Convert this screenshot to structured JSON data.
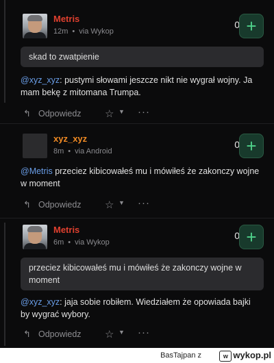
{
  "comments": [
    {
      "author": "Metris",
      "time": "12m",
      "source": "via Wykop",
      "votes": "0",
      "quote": "skad to zwatpienie",
      "mention": "@xyz_xyz",
      "text": ": pustymi słowami jeszcze nikt nie wygrał wojny. Ja mam bekę z mitomana Trumpa.",
      "reply_label": "Odpowiedz"
    },
    {
      "author": "xyz_xyz",
      "time": "8m",
      "source": "via Android",
      "votes": "0",
      "mention": "@Metris",
      "text": " przeciez kibicowałeś mu i mówiłeś że zakonczy wojne w moment",
      "reply_label": "Odpowiedz"
    },
    {
      "author": "Metris",
      "time": "6m",
      "source": "via Wykop",
      "votes": "0",
      "quote": "przeciez kibicowałeś mu i mówiłeś że zakonczy wojne w moment",
      "mention": "@xyz_xyz",
      "text": ": jaja sobie robiłem. Wiedziałem że opowiada bajki by wygrać wybory.",
      "reply_label": "Odpowiedz"
    }
  ],
  "footer": {
    "attribution": "BasTajpan z",
    "site": "wykop.pl"
  },
  "colors": {
    "background": "#0b0b0c",
    "author_red": "#e0402f",
    "author_orange": "#f08a24",
    "mention": "#6a9ee8",
    "plus_green": "#4fd18a"
  },
  "icons": [
    "plus-icon",
    "reply-icon",
    "star-icon",
    "chevron-down-icon",
    "more-icon",
    "wykop-logo-icon"
  ]
}
